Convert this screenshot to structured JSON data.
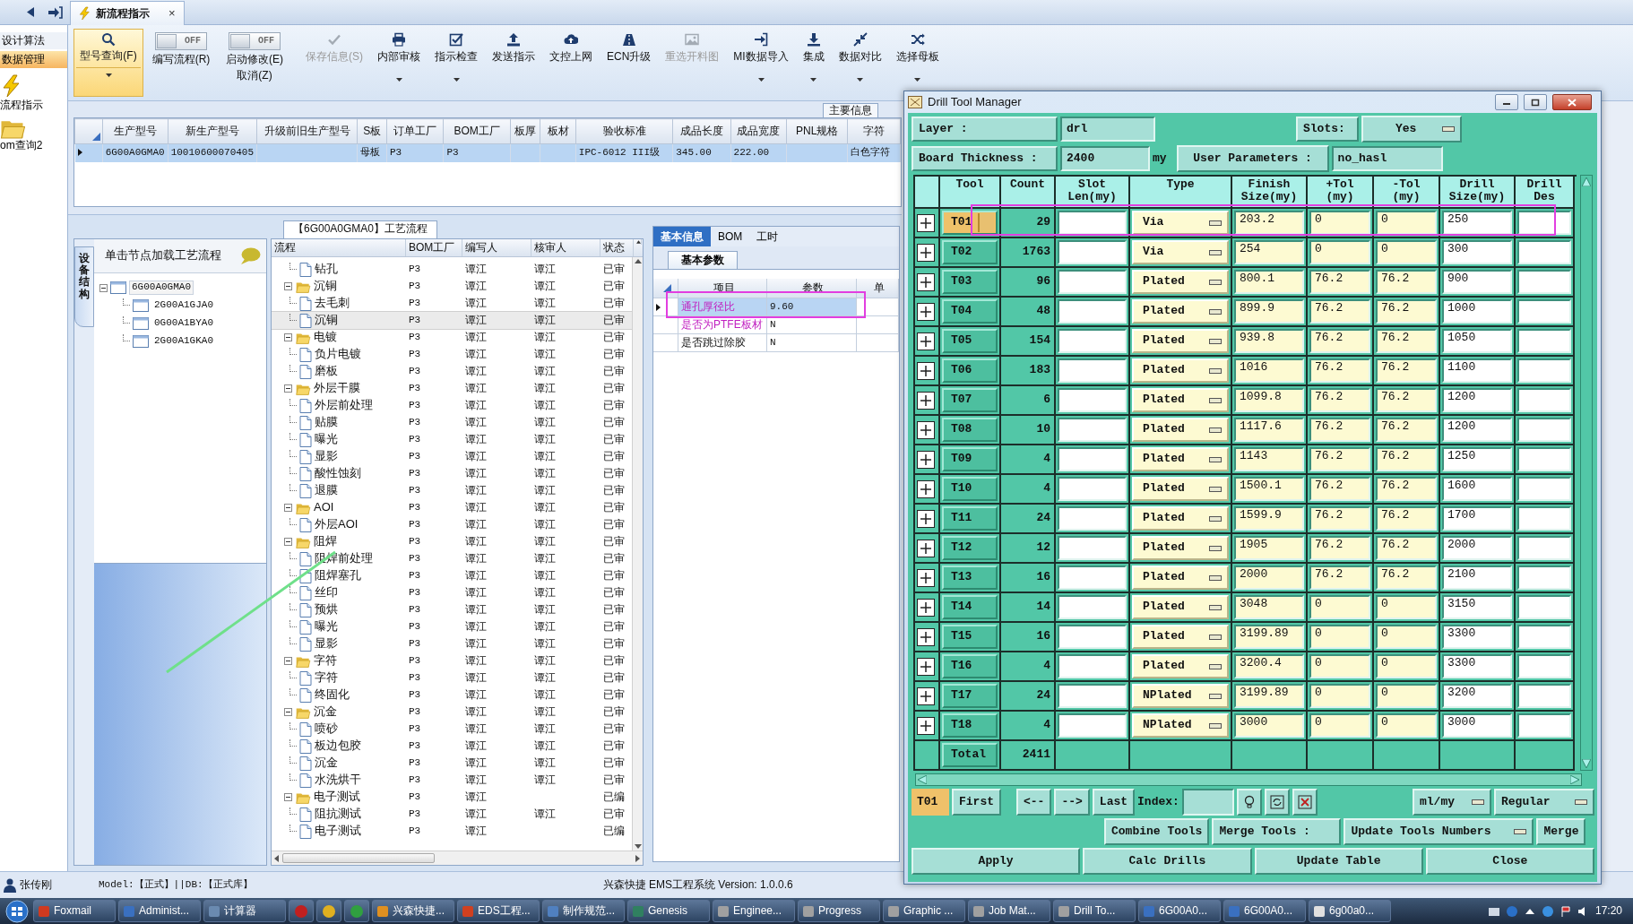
{
  "document_tab": {
    "title": "新流程指示",
    "close": "×"
  },
  "nav_items": [
    {
      "kind": "text",
      "label": "设计算法",
      "selected": false
    },
    {
      "kind": "text",
      "label": "数据管理",
      "selected": true
    },
    {
      "kind": "bolt",
      "label": "流程指示",
      "selected": false
    },
    {
      "kind": "folder",
      "label": "om查询2",
      "selected": false
    }
  ],
  "ribbon": [
    {
      "kind": "split",
      "label": "型号查询(F)",
      "selected": true,
      "dropdown": true
    },
    {
      "kind": "toggle",
      "state_text": "OFF",
      "on": false,
      "label": "编写流程(R)"
    },
    {
      "kind": "toggle",
      "state_text": "OFF",
      "on": false,
      "label": "启动修改(E)",
      "sublabel": "取消(Z)"
    },
    {
      "kind": "button",
      "label": "保存信息(S)",
      "disabled": true,
      "dropdown": false
    },
    {
      "kind": "button",
      "label": "内部审核",
      "disabled": false,
      "dropdown": true
    },
    {
      "kind": "button",
      "label": "指示检查",
      "disabled": false,
      "dropdown": true
    },
    {
      "kind": "button",
      "label": "发送指示",
      "disabled": false,
      "dropdown": false
    },
    {
      "kind": "button",
      "label": "文控上网",
      "disabled": false,
      "dropdown": false
    },
    {
      "kind": "button",
      "label": "ECN升级",
      "disabled": false,
      "dropdown": false
    },
    {
      "kind": "button",
      "label": "重选开料图",
      "disabled": true,
      "dropdown": false
    },
    {
      "kind": "button",
      "label": "MI数据导入",
      "disabled": false,
      "dropdown": true
    },
    {
      "kind": "button",
      "label": "集成",
      "disabled": false,
      "dropdown": true
    },
    {
      "kind": "button",
      "label": "数据对比",
      "disabled": false,
      "dropdown": true
    },
    {
      "kind": "button",
      "label": "选择母板",
      "disabled": false,
      "dropdown": true
    }
  ],
  "main_table": {
    "section_title": "主要信息",
    "columns": [
      "生产型号",
      "新生产型号",
      "升级前旧生产型号",
      "S板",
      "订单工厂",
      "BOM工厂",
      "板厚",
      "板材",
      "验收标准",
      "成品长度",
      "成品宽度",
      "PNL规格",
      "字符"
    ],
    "rows": [
      {
        "selected": true,
        "cells": [
          "6G00A0GMA0",
          "10010600070405",
          "",
          "母板",
          "P3",
          "P3",
          "",
          "",
          "IPC-6012 III级",
          "345.00",
          "222.00",
          "",
          "白色字符"
        ]
      }
    ]
  },
  "process_title": "【6G00A0GMA0】工艺流程",
  "device_panel": {
    "tab": "设备结构",
    "hint": "单击节点加载工艺流程",
    "tree": [
      {
        "label": "6G00A0GMA0",
        "selected": true,
        "expanded": true,
        "children": [
          {
            "label": "2G00A1GJA0",
            "selected": false
          },
          {
            "label": "0G00A1BYA0",
            "selected": false
          },
          {
            "label": "2G00A1GKA0",
            "selected": false
          }
        ]
      }
    ]
  },
  "process_grid": {
    "columns": [
      "流程",
      "BOM工厂",
      "编写人",
      "核审人",
      "状态"
    ],
    "rows": [
      {
        "label": "钻孔",
        "bom": "P3",
        "writer": "谭江",
        "reviewer": "谭江",
        "status": "已审",
        "selected": false
      },
      {
        "label": "沉铜",
        "bom": "P3",
        "writer": "谭江",
        "reviewer": "谭江",
        "status": "已审",
        "selected": false,
        "expanded": true,
        "children": [
          {
            "label": "去毛刺",
            "bom": "P3",
            "writer": "谭江",
            "reviewer": "谭江",
            "status": "已审",
            "selected": false
          },
          {
            "label": "沉铜",
            "bom": "P3",
            "writer": "谭江",
            "reviewer": "谭江",
            "status": "已审",
            "selected": true
          }
        ]
      },
      {
        "label": "电镀",
        "bom": "P3",
        "writer": "谭江",
        "reviewer": "谭江",
        "status": "已审",
        "selected": false,
        "expanded": true,
        "children": [
          {
            "label": "负片电镀",
            "bom": "P3",
            "writer": "谭江",
            "reviewer": "谭江",
            "status": "已审",
            "selected": false
          },
          {
            "label": "磨板",
            "bom": "P3",
            "writer": "谭江",
            "reviewer": "谭江",
            "status": "已审",
            "selected": false
          }
        ]
      },
      {
        "label": "外层干膜",
        "bom": "P3",
        "writer": "谭江",
        "reviewer": "谭江",
        "status": "已审",
        "selected": false,
        "expanded": true,
        "children": [
          {
            "label": "外层前处理",
            "bom": "P3",
            "writer": "谭江",
            "reviewer": "谭江",
            "status": "已审",
            "selected": false
          },
          {
            "label": "贴膜",
            "bom": "P3",
            "writer": "谭江",
            "reviewer": "谭江",
            "status": "已审",
            "selected": false
          },
          {
            "label": "曝光",
            "bom": "P3",
            "writer": "谭江",
            "reviewer": "谭江",
            "status": "已审",
            "selected": false
          },
          {
            "label": "显影",
            "bom": "P3",
            "writer": "谭江",
            "reviewer": "谭江",
            "status": "已审",
            "selected": false
          },
          {
            "label": "酸性蚀刻",
            "bom": "P3",
            "writer": "谭江",
            "reviewer": "谭江",
            "status": "已审",
            "selected": false
          },
          {
            "label": "退膜",
            "bom": "P3",
            "writer": "谭江",
            "reviewer": "谭江",
            "status": "已审",
            "selected": false
          }
        ]
      },
      {
        "label": "AOI",
        "bom": "P3",
        "writer": "谭江",
        "reviewer": "谭江",
        "status": "已审",
        "selected": false,
        "expanded": true,
        "children": [
          {
            "label": "外层AOI",
            "bom": "P3",
            "writer": "谭江",
            "reviewer": "谭江",
            "status": "已审",
            "selected": false
          }
        ]
      },
      {
        "label": "阻焊",
        "bom": "P3",
        "writer": "谭江",
        "reviewer": "谭江",
        "status": "已审",
        "selected": false,
        "expanded": true,
        "children": [
          {
            "label": "阻焊前处理",
            "bom": "P3",
            "writer": "谭江",
            "reviewer": "谭江",
            "status": "已审",
            "selected": false
          },
          {
            "label": "阻焊塞孔",
            "bom": "P3",
            "writer": "谭江",
            "reviewer": "谭江",
            "status": "已审",
            "selected": false
          },
          {
            "label": "丝印",
            "bom": "P3",
            "writer": "谭江",
            "reviewer": "谭江",
            "status": "已审",
            "selected": false
          },
          {
            "label": "预烘",
            "bom": "P3",
            "writer": "谭江",
            "reviewer": "谭江",
            "status": "已审",
            "selected": false
          },
          {
            "label": "曝光",
            "bom": "P3",
            "writer": "谭江",
            "reviewer": "谭江",
            "status": "已审",
            "selected": false
          },
          {
            "label": "显影",
            "bom": "P3",
            "writer": "谭江",
            "reviewer": "谭江",
            "status": "已审",
            "selected": false
          }
        ]
      },
      {
        "label": "字符",
        "bom": "P3",
        "writer": "谭江",
        "reviewer": "谭江",
        "status": "已审",
        "selected": false,
        "expanded": true,
        "children": [
          {
            "label": "字符",
            "bom": "P3",
            "writer": "谭江",
            "reviewer": "谭江",
            "status": "已审",
            "selected": false
          },
          {
            "label": "终固化",
            "bom": "P3",
            "writer": "谭江",
            "reviewer": "谭江",
            "status": "已审",
            "selected": false
          }
        ]
      },
      {
        "label": "沉金",
        "bom": "P3",
        "writer": "谭江",
        "reviewer": "谭江",
        "status": "已审",
        "selected": false,
        "expanded": true,
        "children": [
          {
            "label": "喷砂",
            "bom": "P3",
            "writer": "谭江",
            "reviewer": "谭江",
            "status": "已审",
            "selected": false
          },
          {
            "label": "板边包胶",
            "bom": "P3",
            "writer": "谭江",
            "reviewer": "谭江",
            "status": "已审",
            "selected": false
          },
          {
            "label": "沉金",
            "bom": "P3",
            "writer": "谭江",
            "reviewer": "谭江",
            "status": "已审",
            "selected": false
          },
          {
            "label": "水洗烘干",
            "bom": "P3",
            "writer": "谭江",
            "reviewer": "谭江",
            "status": "已审",
            "selected": false
          }
        ]
      },
      {
        "label": "电子测试",
        "bom": "P3",
        "writer": "谭江",
        "status": "已编",
        "selected": false,
        "expanded": true,
        "children": [
          {
            "label": "阻抗测试",
            "bom": "P3",
            "writer": "谭江",
            "reviewer": "谭江",
            "status": "已审",
            "selected": false
          },
          {
            "label": "电子测试",
            "bom": "P3",
            "writer": "谭江",
            "status": "已编",
            "selected": false
          }
        ]
      }
    ]
  },
  "info_panel": {
    "tabs": [
      {
        "label": "基本信息",
        "selected": true
      },
      {
        "label": "BOM",
        "selected": false
      },
      {
        "label": "工时",
        "selected": false
      }
    ],
    "subtabs": [
      {
        "label": "基本参数",
        "selected": true
      }
    ],
    "columns": [
      "项目",
      "参数",
      "单"
    ],
    "rows": [
      {
        "item": "通孔厚径比",
        "value": "9.60",
        "selected": true,
        "flagged": true
      },
      {
        "item": "是否为PTFE板材",
        "value": "N",
        "selected": false,
        "flagged": true
      },
      {
        "item": "是否跳过除胶",
        "value": "N",
        "selected": false,
        "flagged": false
      }
    ]
  },
  "status_bar": {
    "user": "张传刚",
    "model": "Model:【正式】||DB:【正式库】",
    "version": "兴森快捷 EMS工程系统 Version: 1.0.0.6"
  },
  "drill_window": {
    "title": "Drill Tool Manager",
    "layer": {
      "label": "Layer :",
      "value": "drl"
    },
    "slots": {
      "label": "Slots:",
      "value": "Yes"
    },
    "thickness": {
      "label": "Board Thickness :",
      "value": "2400",
      "unit": "my"
    },
    "user_params": {
      "label": "User Parameters :",
      "value": "no_hasl"
    },
    "columns": [
      "Tool",
      "Count",
      "Slot Len(my)",
      "Type",
      "Finish Size(my)",
      "+Tol (my)",
      "-Tol (my)",
      "Drill Size(my)",
      "Drill Des"
    ],
    "rows": [
      {
        "tool": "T01",
        "count": "29",
        "type": "Via",
        "finish_size": "203.2",
        "plus_tol": "0",
        "minus_tol": "0",
        "drill_size": "250",
        "selected": true
      },
      {
        "tool": "T02",
        "count": "1763",
        "type": "Via",
        "finish_size": "254",
        "plus_tol": "0",
        "minus_tol": "0",
        "drill_size": "300",
        "selected": false
      },
      {
        "tool": "T03",
        "count": "96",
        "type": "Plated",
        "finish_size": "800.1",
        "plus_tol": "76.2",
        "minus_tol": "76.2",
        "drill_size": "900",
        "selected": false
      },
      {
        "tool": "T04",
        "count": "48",
        "type": "Plated",
        "finish_size": "899.9",
        "plus_tol": "76.2",
        "minus_tol": "76.2",
        "drill_size": "1000",
        "selected": false
      },
      {
        "tool": "T05",
        "count": "154",
        "type": "Plated",
        "finish_size": "939.8",
        "plus_tol": "76.2",
        "minus_tol": "76.2",
        "drill_size": "1050",
        "selected": false
      },
      {
        "tool": "T06",
        "count": "183",
        "type": "Plated",
        "finish_size": "1016",
        "plus_tol": "76.2",
        "minus_tol": "76.2",
        "drill_size": "1100",
        "selected": false
      },
      {
        "tool": "T07",
        "count": "6",
        "type": "Plated",
        "finish_size": "1099.8",
        "plus_tol": "76.2",
        "minus_tol": "76.2",
        "drill_size": "1200",
        "selected": false
      },
      {
        "tool": "T08",
        "count": "10",
        "type": "Plated",
        "finish_size": "1117.6",
        "plus_tol": "76.2",
        "minus_tol": "76.2",
        "drill_size": "1200",
        "selected": false
      },
      {
        "tool": "T09",
        "count": "4",
        "type": "Plated",
        "finish_size": "1143",
        "plus_tol": "76.2",
        "minus_tol": "76.2",
        "drill_size": "1250",
        "selected": false
      },
      {
        "tool": "T10",
        "count": "4",
        "type": "Plated",
        "finish_size": "1500.1",
        "plus_tol": "76.2",
        "minus_tol": "76.2",
        "drill_size": "1600",
        "selected": false
      },
      {
        "tool": "T11",
        "count": "24",
        "type": "Plated",
        "finish_size": "1599.9",
        "plus_tol": "76.2",
        "minus_tol": "76.2",
        "drill_size": "1700",
        "selected": false
      },
      {
        "tool": "T12",
        "count": "12",
        "type": "Plated",
        "finish_size": "1905",
        "plus_tol": "76.2",
        "minus_tol": "76.2",
        "drill_size": "2000",
        "selected": false
      },
      {
        "tool": "T13",
        "count": "16",
        "type": "Plated",
        "finish_size": "2000",
        "plus_tol": "76.2",
        "minus_tol": "76.2",
        "drill_size": "2100",
        "selected": false
      },
      {
        "tool": "T14",
        "count": "14",
        "type": "Plated",
        "finish_size": "3048",
        "plus_tol": "0",
        "minus_tol": "0",
        "drill_size": "3150",
        "selected": false
      },
      {
        "tool": "T15",
        "count": "16",
        "type": "Plated",
        "finish_size": "3199.89",
        "plus_tol": "0",
        "minus_tol": "0",
        "drill_size": "3300",
        "selected": false
      },
      {
        "tool": "T16",
        "count": "4",
        "type": "Plated",
        "finish_size": "3200.4",
        "plus_tol": "0",
        "minus_tol": "0",
        "drill_size": "3300",
        "selected": false
      },
      {
        "tool": "T17",
        "count": "24",
        "type": "NPlated",
        "finish_size": "3199.89",
        "plus_tol": "0",
        "minus_tol": "0",
        "drill_size": "3200",
        "selected": false
      },
      {
        "tool": "T18",
        "count": "4",
        "type": "NPlated",
        "finish_size": "3000",
        "plus_tol": "0",
        "minus_tol": "0",
        "drill_size": "3000",
        "selected": false
      }
    ],
    "total": {
      "label": "Total",
      "count": "2411"
    },
    "nav": {
      "current": "T01",
      "buttons": [
        "First",
        "<--",
        "-->",
        "Last"
      ],
      "index_label": "Index:",
      "units": "ml/my",
      "mode": "Regular"
    },
    "merge": {
      "combine": "Combine Tools",
      "merge_label": "Merge Tools :",
      "merge_option": "Update Tools Numbers",
      "merge_button": "Merge"
    },
    "actions": [
      "Apply",
      "Calc Drills",
      "Update Table",
      "Close"
    ]
  },
  "taskbar": {
    "items": [
      {
        "kind": "app",
        "label": "Foxmail"
      },
      {
        "kind": "app",
        "label": "Administ..."
      },
      {
        "kind": "app",
        "label": "计算器"
      },
      {
        "kind": "icon"
      },
      {
        "kind": "icon"
      },
      {
        "kind": "icon"
      },
      {
        "kind": "app",
        "label": "兴森快捷..."
      },
      {
        "kind": "app",
        "label": "EDS工程..."
      },
      {
        "kind": "app",
        "label": "制作规范..."
      },
      {
        "kind": "app",
        "label": "Genesis"
      },
      {
        "kind": "app",
        "label": "Enginee..."
      },
      {
        "kind": "app",
        "label": "Progress"
      },
      {
        "kind": "app",
        "label": "Graphic ..."
      },
      {
        "kind": "app",
        "label": "Job Mat..."
      },
      {
        "kind": "app",
        "label": "Drill To..."
      },
      {
        "kind": "app",
        "label": "6G00A0..."
      },
      {
        "kind": "app",
        "label": "6G00A0..."
      },
      {
        "kind": "app",
        "label": "6g00a0..."
      }
    ],
    "clock": "17:20"
  }
}
